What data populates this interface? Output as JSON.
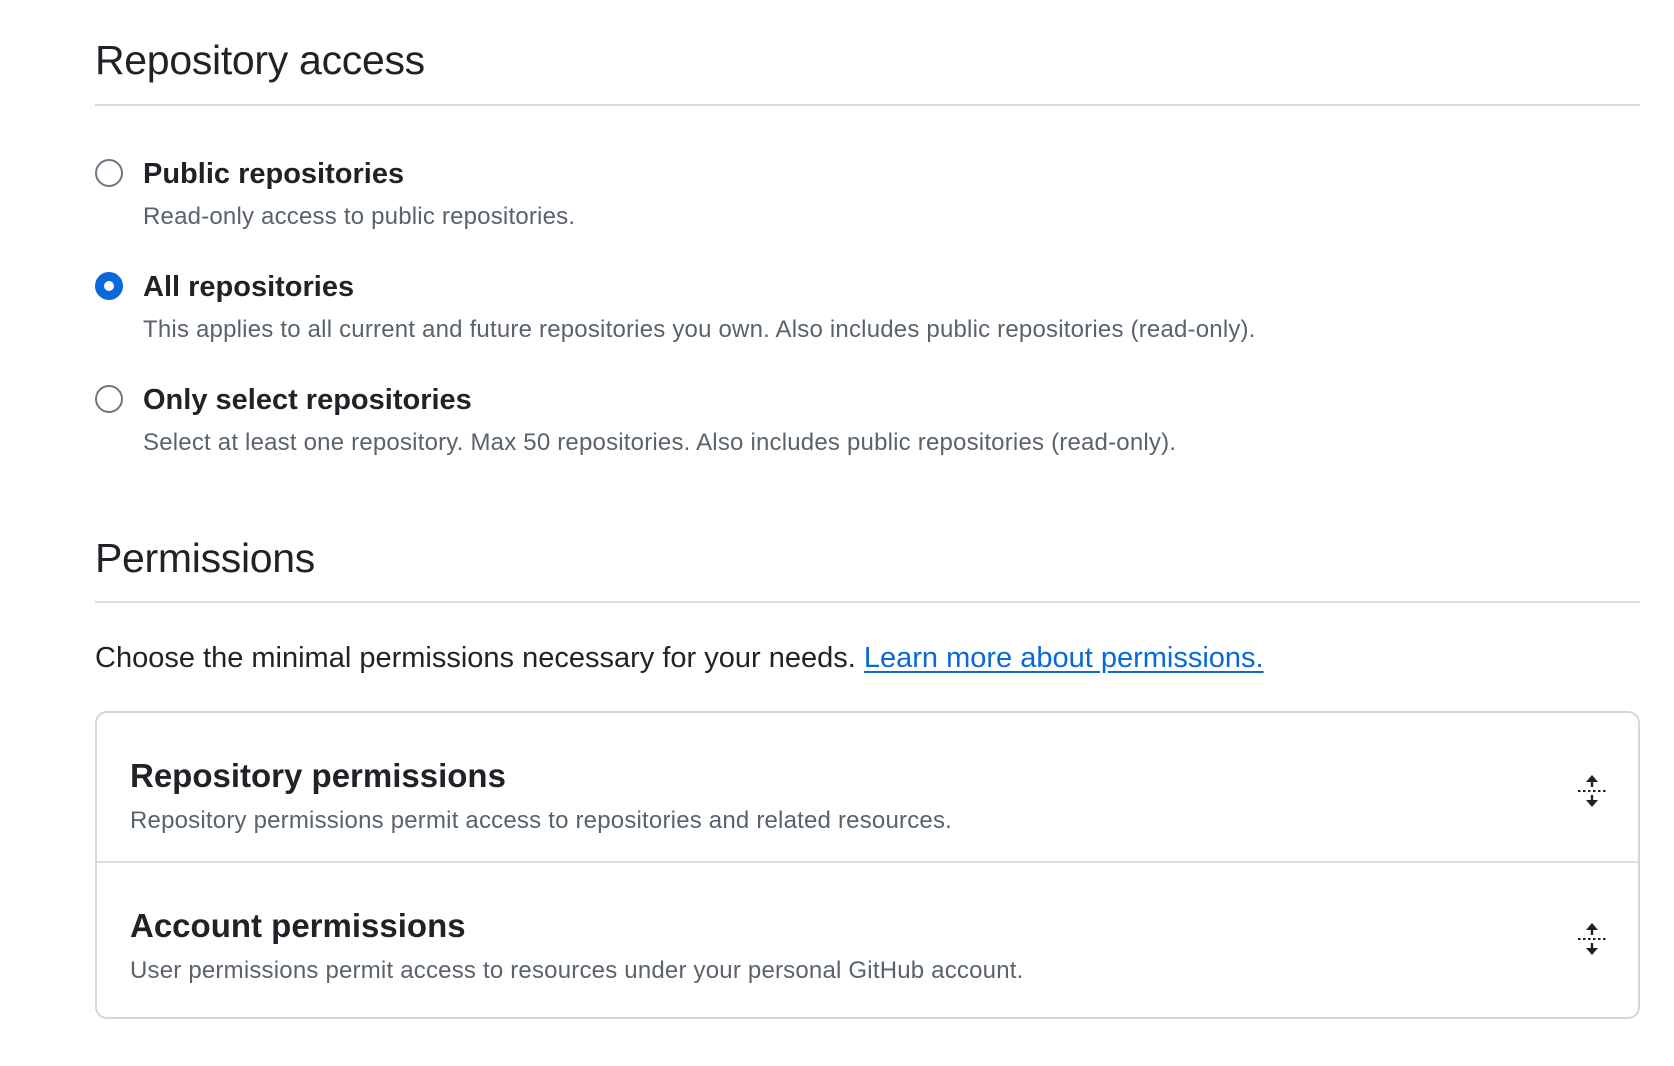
{
  "repository_access": {
    "title": "Repository access",
    "options": [
      {
        "label": "Public repositories",
        "description": "Read-only access to public repositories.",
        "selected": false
      },
      {
        "label": "All repositories",
        "description": "This applies to all current and future repositories you own. Also includes public repositories (read-only).",
        "selected": true
      },
      {
        "label": "Only select repositories",
        "description": "Select at least one repository. Max 50 repositories. Also includes public repositories (read-only).",
        "selected": false
      }
    ]
  },
  "permissions": {
    "title": "Permissions",
    "intro_text": "Choose the minimal permissions necessary for your needs.",
    "learn_more_link": "Learn more about permissions.",
    "groups": [
      {
        "title": "Repository permissions",
        "description": "Repository permissions permit access to repositories and related resources.",
        "icon": "unfold-icon"
      },
      {
        "title": "Account permissions",
        "description": "User permissions permit access to resources under your personal GitHub account.",
        "icon": "unfold-icon"
      }
    ]
  },
  "colors": {
    "accent": "#0969da",
    "text_primary": "#1f2328",
    "text_muted": "#59636e",
    "border": "#d0d7de"
  }
}
